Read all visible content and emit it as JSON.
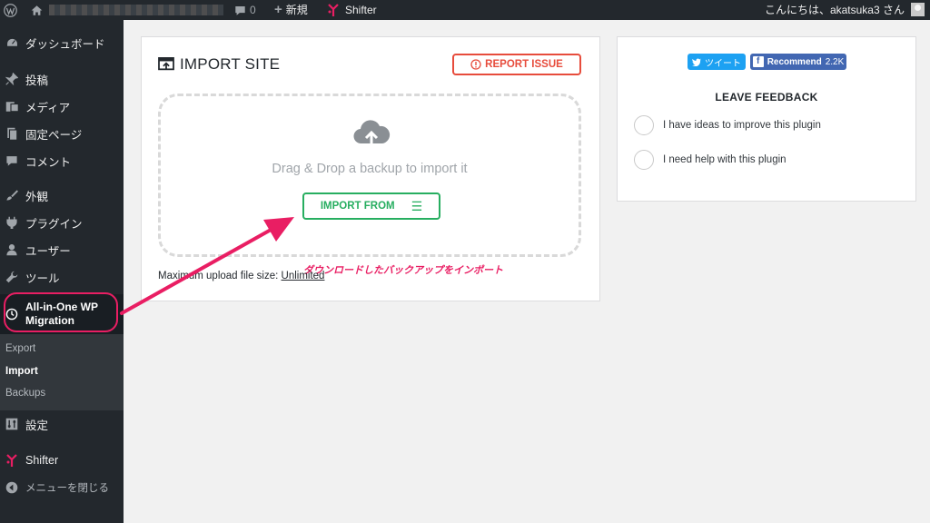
{
  "adminbar": {
    "new_label": "新規",
    "comments_count": "0",
    "site_name": "Shifter",
    "greeting": "こんにちは、akatsuka3 さん"
  },
  "sidebar": {
    "items": [
      {
        "label": "ダッシュボード",
        "icon": "dashboard-icon"
      },
      {
        "label": "投稿",
        "icon": "pin-icon"
      },
      {
        "label": "メディア",
        "icon": "media-icon"
      },
      {
        "label": "固定ページ",
        "icon": "page-icon"
      },
      {
        "label": "コメント",
        "icon": "comment-icon"
      },
      {
        "label": "外観",
        "icon": "brush-icon"
      },
      {
        "label": "プラグイン",
        "icon": "plug-icon"
      },
      {
        "label": "ユーザー",
        "icon": "user-icon"
      },
      {
        "label": "ツール",
        "icon": "wrench-icon"
      }
    ],
    "plugin": {
      "line1": "All-in-One WP",
      "line2": "Migration"
    },
    "submenu": [
      {
        "label": "Export",
        "active": false
      },
      {
        "label": "Import",
        "active": true
      },
      {
        "label": "Backups",
        "active": false
      }
    ],
    "settings": "設定",
    "shifter": "Shifter",
    "collapse": "メニューを閉じる"
  },
  "import": {
    "title": "IMPORT SITE",
    "report_issue": "REPORT ISSUE",
    "drop_text": "Drag & Drop a backup to import it",
    "import_from": "IMPORT FROM",
    "max_upload_prefix": "Maximum upload file size:",
    "max_upload_value": "Unlimited"
  },
  "annotation": {
    "text": "ダウンロードしたバックアップをインポート",
    "color": "#e91e63"
  },
  "feedback": {
    "tweet": "ツイート",
    "recommend": "Recommend",
    "recommend_count": "2.2K",
    "title": "LEAVE FEEDBACK",
    "options": [
      "I have ideas to improve this plugin",
      "I need help with this plugin"
    ]
  },
  "colors": {
    "adminbar_bg": "#23282d",
    "report_red": "#e74c3c",
    "import_green": "#27ae60",
    "twitter_blue": "#1da1f2",
    "facebook_blue": "#4267b2"
  }
}
